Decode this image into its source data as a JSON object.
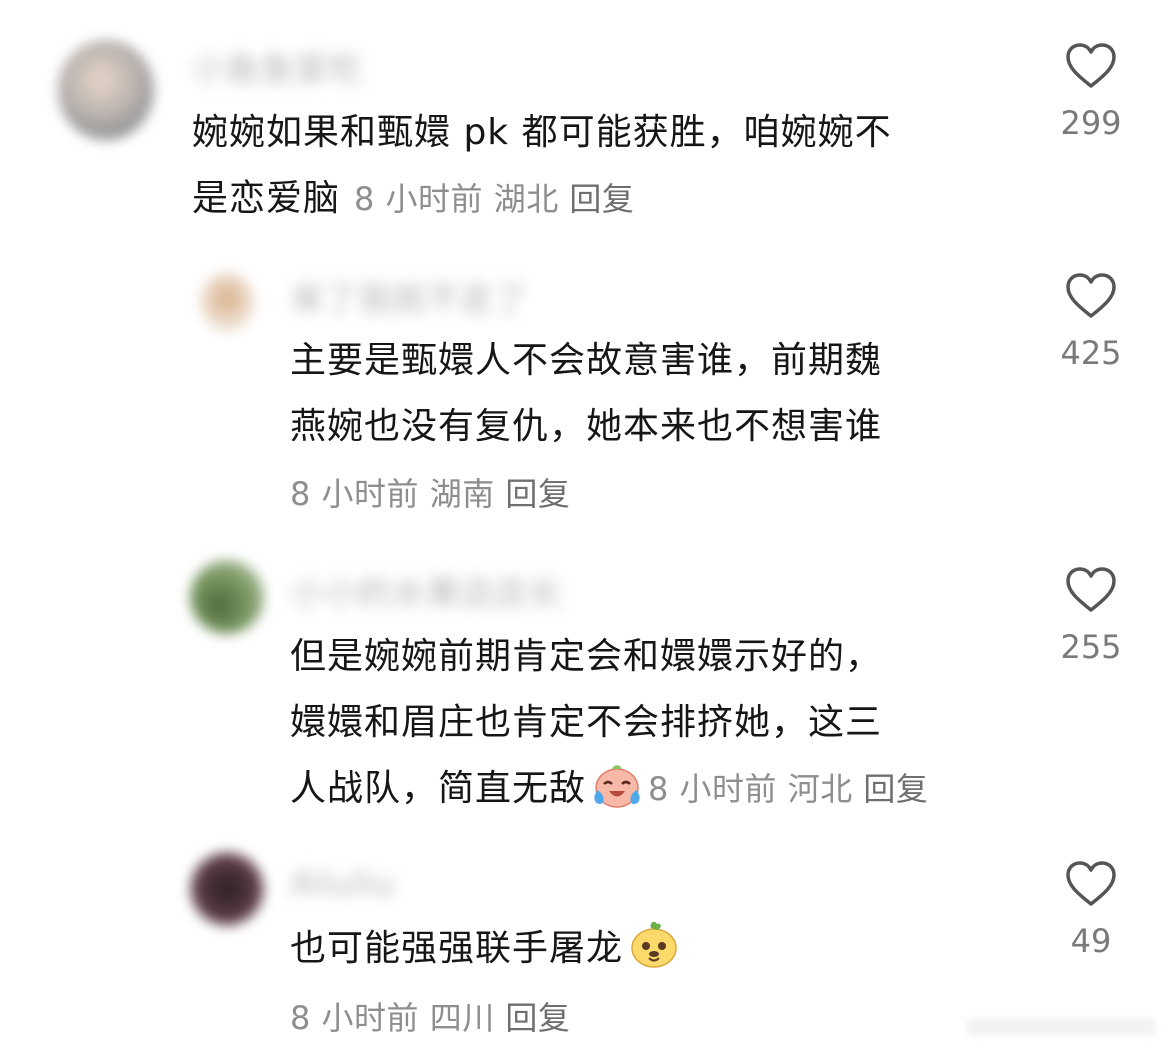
{
  "comments": [
    {
      "username": "小鱼鱼爱吃",
      "text_line1": "婉婉如果和甄嬛 pk 都可能获胜，咱婉婉不",
      "text_line2": "是恋爱脑",
      "time": "8 小时前",
      "location": "湖北",
      "reply_label": "回复",
      "likes": "299",
      "avatar_color": "#9aa3ad"
    },
    {
      "username": "来了我就不走了",
      "text_line1": "主要是甄嬛人不会故意害谁，前期魏",
      "text_line2": "燕婉也没有复仇，她本来也不想害谁",
      "time": "8 小时前",
      "location": "湖南",
      "reply_label": "回复",
      "likes": "425",
      "avatar_color": "#d9c2a8"
    },
    {
      "username": "小小的水果店店长",
      "text_line1": "但是婉婉前期肯定会和嬛嬛示好的，",
      "text_line2": "嬛嬛和眉庄也肯定不会排挤她，这三",
      "text_line3": "人战队，简直无敌",
      "time": "8 小时前",
      "location": "河北",
      "reply_label": "回复",
      "likes": "255",
      "avatar_color": "#5d7a4a"
    },
    {
      "username": "Aliuliu",
      "text_line1": "也可能强强联手屠龙",
      "time": "8 小时前",
      "location": "四川",
      "reply_label": "回复",
      "likes": "49",
      "avatar_color": "#3a2a30"
    }
  ],
  "icons": {
    "like": "heart-outline-icon",
    "emoji_cry_laugh": "crying-laughing-emoji",
    "emoji_dog": "doge-emoji"
  },
  "colors": {
    "text": "#161616",
    "meta": "#8e8e8e",
    "likes": "#7a7a7a"
  }
}
